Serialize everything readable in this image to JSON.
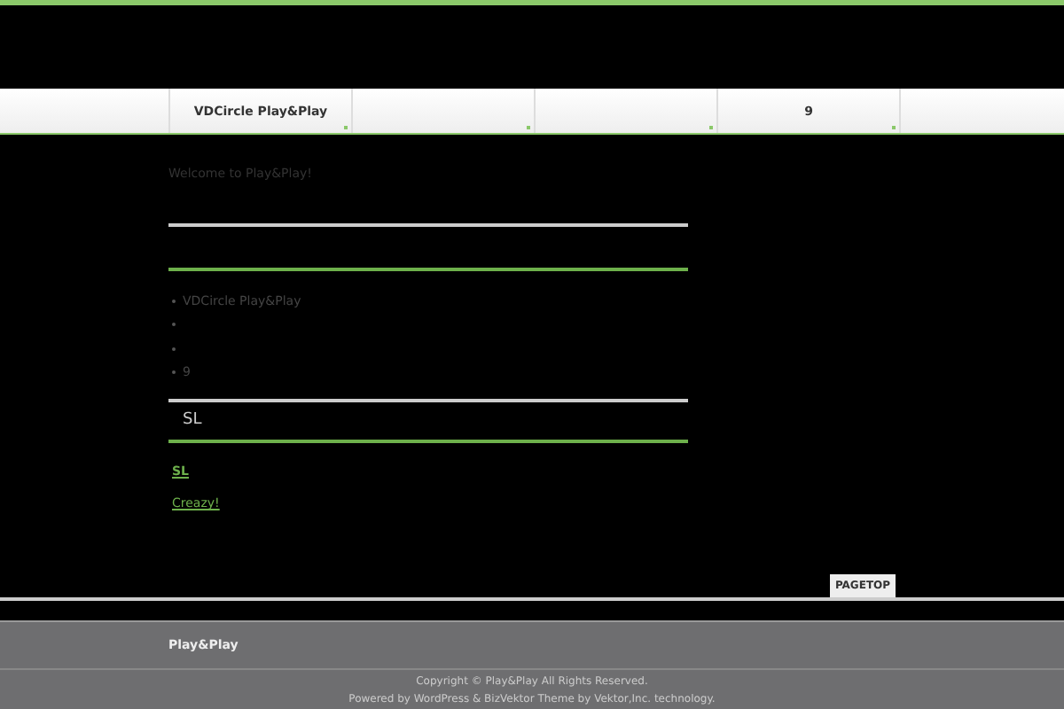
{
  "nav": {
    "items": [
      {
        "kind": "text",
        "label": "VDCircle Play&Play"
      },
      {
        "kind": "blank"
      },
      {
        "kind": "blank"
      },
      {
        "kind": "text",
        "label": "9"
      }
    ]
  },
  "welcome": "Welcome to Play&Play!",
  "menu_list": [
    {
      "kind": "text",
      "label": "VDCircle Play&Play"
    },
    {
      "kind": "blank"
    },
    {
      "kind": "blank"
    },
    {
      "kind": "text",
      "label": "9"
    }
  ],
  "section_heading": "SL",
  "links": [
    "SL",
    "Creazy!"
  ],
  "pagetop": "PAGETOP",
  "footer": {
    "site_name": "Play&Play",
    "copyright": "Copyright © Play&Play All Rights Reserved.",
    "powered": "Powered by WordPress & BizVektor Theme by Vektor,Inc. technology."
  }
}
